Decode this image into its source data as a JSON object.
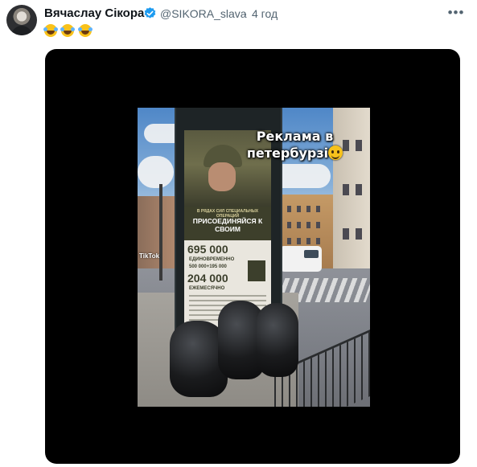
{
  "post": {
    "author_name": "Вячаслау Сікора",
    "handle": "@SIKORA_slava",
    "separator": "·",
    "time": "4 год",
    "more_icon": "more-horizontal-icon",
    "verified_icon": "verified-badge-icon",
    "emoji_icon": "rolling-on-floor-laughing-emoji",
    "emoji_count": 3
  },
  "media": {
    "overlay_caption": "Реклама в петербурзі",
    "overlay_emoji": "grinning-sweat-emoji",
    "watermark": "TikTok",
    "poster": {
      "small_text": "В РЯДАХ СИЛ СПЕЦИАЛЬНЫХ ОПЕРАЦИЙ",
      "headline": "ПРИСОЕДИНЯЙСЯ К СВОИМ",
      "amount_1": "695 000",
      "note_1": "ЕДИНОВРЕМЕННО",
      "note_2": "500 000+195 000",
      "amount_2": "204 000",
      "note_3": "ЕЖЕМЕСЯЧНО"
    }
  },
  "colors": {
    "text_primary": "#0f1419",
    "text_secondary": "#536471",
    "verified_blue": "#1d9bf0",
    "media_background": "#000000"
  }
}
